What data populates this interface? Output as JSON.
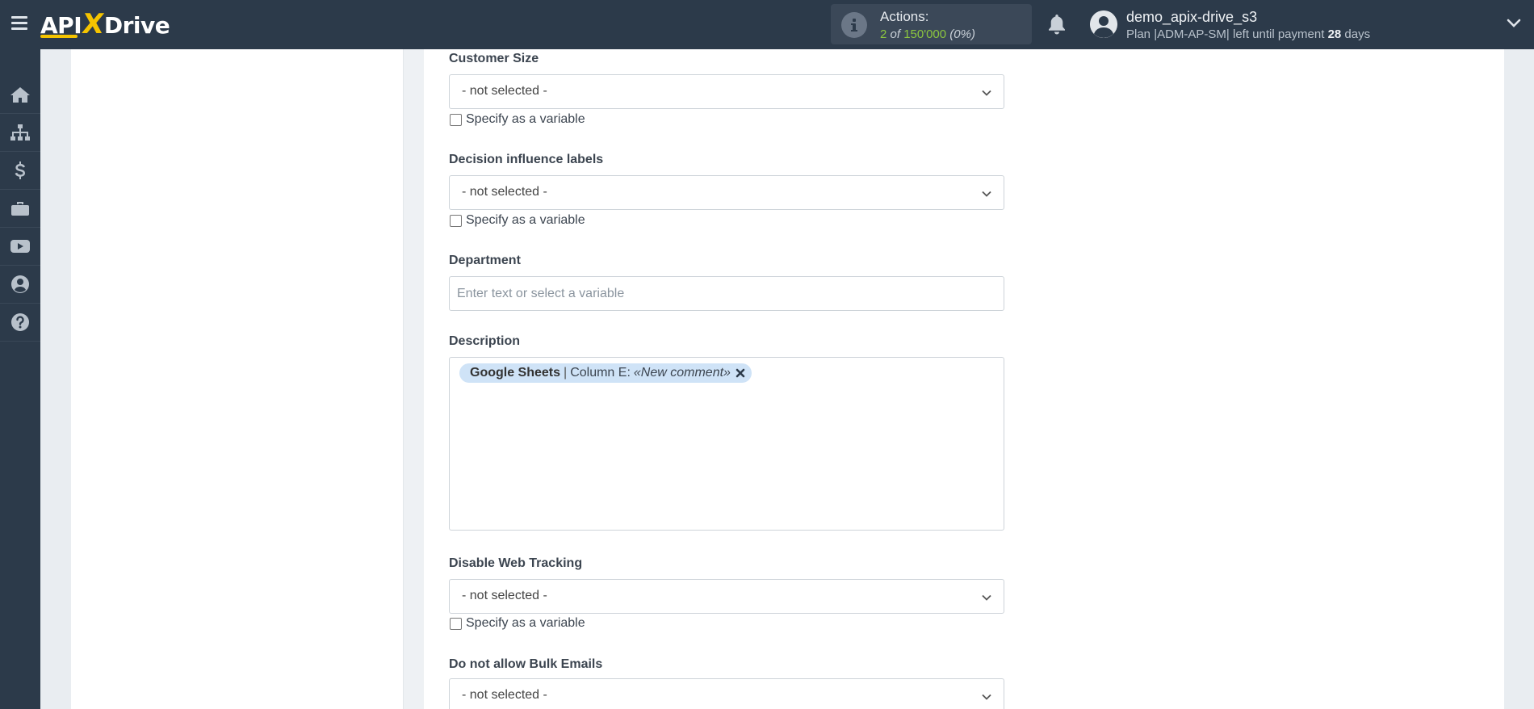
{
  "header": {
    "logo_text_left": "API",
    "logo_text_x": "X",
    "logo_text_right": "Drive",
    "actions": {
      "title": "Actions:",
      "used": "2",
      "of_label": "of",
      "limit": "150'000",
      "percent": "(0%)"
    },
    "user": {
      "name": "demo_apix-drive_s3",
      "plan_prefix": "Plan |ADM-AP-SM| left until payment",
      "days_left": "28",
      "days_label": "days"
    }
  },
  "sidebar": {
    "items": [
      {
        "icon": "home-icon"
      },
      {
        "icon": "sitemap-icon"
      },
      {
        "icon": "dollar-icon"
      },
      {
        "icon": "briefcase-icon"
      },
      {
        "icon": "youtube-icon"
      },
      {
        "icon": "user-circle-icon"
      },
      {
        "icon": "question-circle-icon"
      }
    ]
  },
  "form": {
    "customer_size": {
      "label": "Customer Size",
      "value": "- not selected -",
      "variable_label": "Specify as a variable"
    },
    "decision_influence": {
      "label": "Decision influence labels",
      "value": "- not selected -",
      "variable_label": "Specify as a variable"
    },
    "department": {
      "label": "Department",
      "placeholder": "Enter text or select a variable"
    },
    "description": {
      "label": "Description",
      "tag_source": "Google Sheets",
      "tag_sep": "|",
      "tag_column": "Column E:",
      "tag_value": "«New comment»"
    },
    "disable_web_tracking": {
      "label": "Disable Web Tracking",
      "value": "- not selected -",
      "variable_label": "Specify as a variable"
    },
    "bulk_emails": {
      "label": "Do not allow Bulk Emails",
      "value": "- not selected -"
    }
  },
  "colors": {
    "topbar": "#2c3a4a",
    "accent_yellow": "#f5c400",
    "actions_green": "#8cc63f",
    "tag_bg": "#cfe3f7"
  }
}
